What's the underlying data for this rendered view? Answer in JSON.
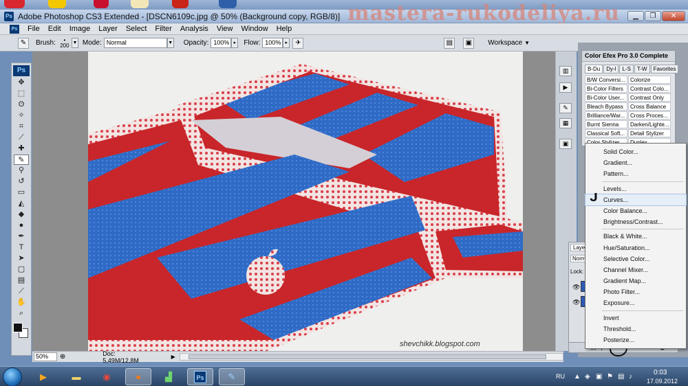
{
  "window": {
    "title": "Adobe Photoshop CS3 Extended - [DSCN6109c.jpg @ 50% (Background copy, RGB/8)]",
    "app_icon": "Ps"
  },
  "watermark": "mastera-rukodeliya.ru",
  "menu": [
    "File",
    "Edit",
    "Image",
    "Layer",
    "Select",
    "Filter",
    "Analysis",
    "View",
    "Window",
    "Help"
  ],
  "options": {
    "brush_label": "Brush:",
    "brush_size": "200",
    "mode_label": "Mode:",
    "mode_value": "Normal",
    "opacity_label": "Opacity:",
    "opacity_value": "100%",
    "flow_label": "Flow:",
    "flow_value": "100%",
    "workspace": "Workspace"
  },
  "toolbox": {
    "badge": "Ps"
  },
  "canvas": {
    "credit": "shevchikk.blogspot.com"
  },
  "status": {
    "zoom": "50%",
    "doc": "Doc: 5,49M/12,8M"
  },
  "color_efex": {
    "title": "Color Efex Pro 3.0 Complete",
    "tabs": [
      "B-Du",
      "Dy-l",
      "L-S",
      "T-W",
      "Favorites"
    ],
    "filters": [
      [
        "B/W Conversi...",
        "Colorize"
      ],
      [
        "Bi-Color Filters",
        "Contrast Colo..."
      ],
      [
        "Bi-Color User...",
        "Contrast Only"
      ],
      [
        "Bleach Bypass",
        "Cross Balance"
      ],
      [
        "Brilliance/War...",
        "Cross Proces..."
      ],
      [
        "Burnt Sienna",
        "Darken/Lighte..."
      ],
      [
        "Classical Soft...",
        "Detail Stylizer"
      ],
      [
        "Color Stylizer",
        "Duplex"
      ]
    ]
  },
  "layers": {
    "tab": "Laye",
    "mode": "Norm",
    "lock": "Lock:"
  },
  "adjust_menu": {
    "group1": [
      "Solid Color...",
      "Gradient...",
      "Pattern..."
    ],
    "group2": [
      "Levels...",
      "Curves...",
      "Color Balance...",
      "Brightness/Contrast..."
    ],
    "group3": [
      "Black & White...",
      "Hue/Saturation...",
      "Selective Color...",
      "Channel Mixer...",
      "Gradient Map...",
      "Photo Filter...",
      "Exposure..."
    ],
    "group4": [
      "Invert",
      "Threshold...",
      "Posterize..."
    ],
    "highlighted": "Curves..."
  },
  "taskbar": {
    "lang": "RU",
    "time": "0:03",
    "date": "17.09.2012"
  },
  "colors": {
    "ps_blue": "#0b3a75",
    "quilt_red": "#c8262a",
    "quilt_blue": "#2f6bc6",
    "taskbar": "#2a4466"
  }
}
